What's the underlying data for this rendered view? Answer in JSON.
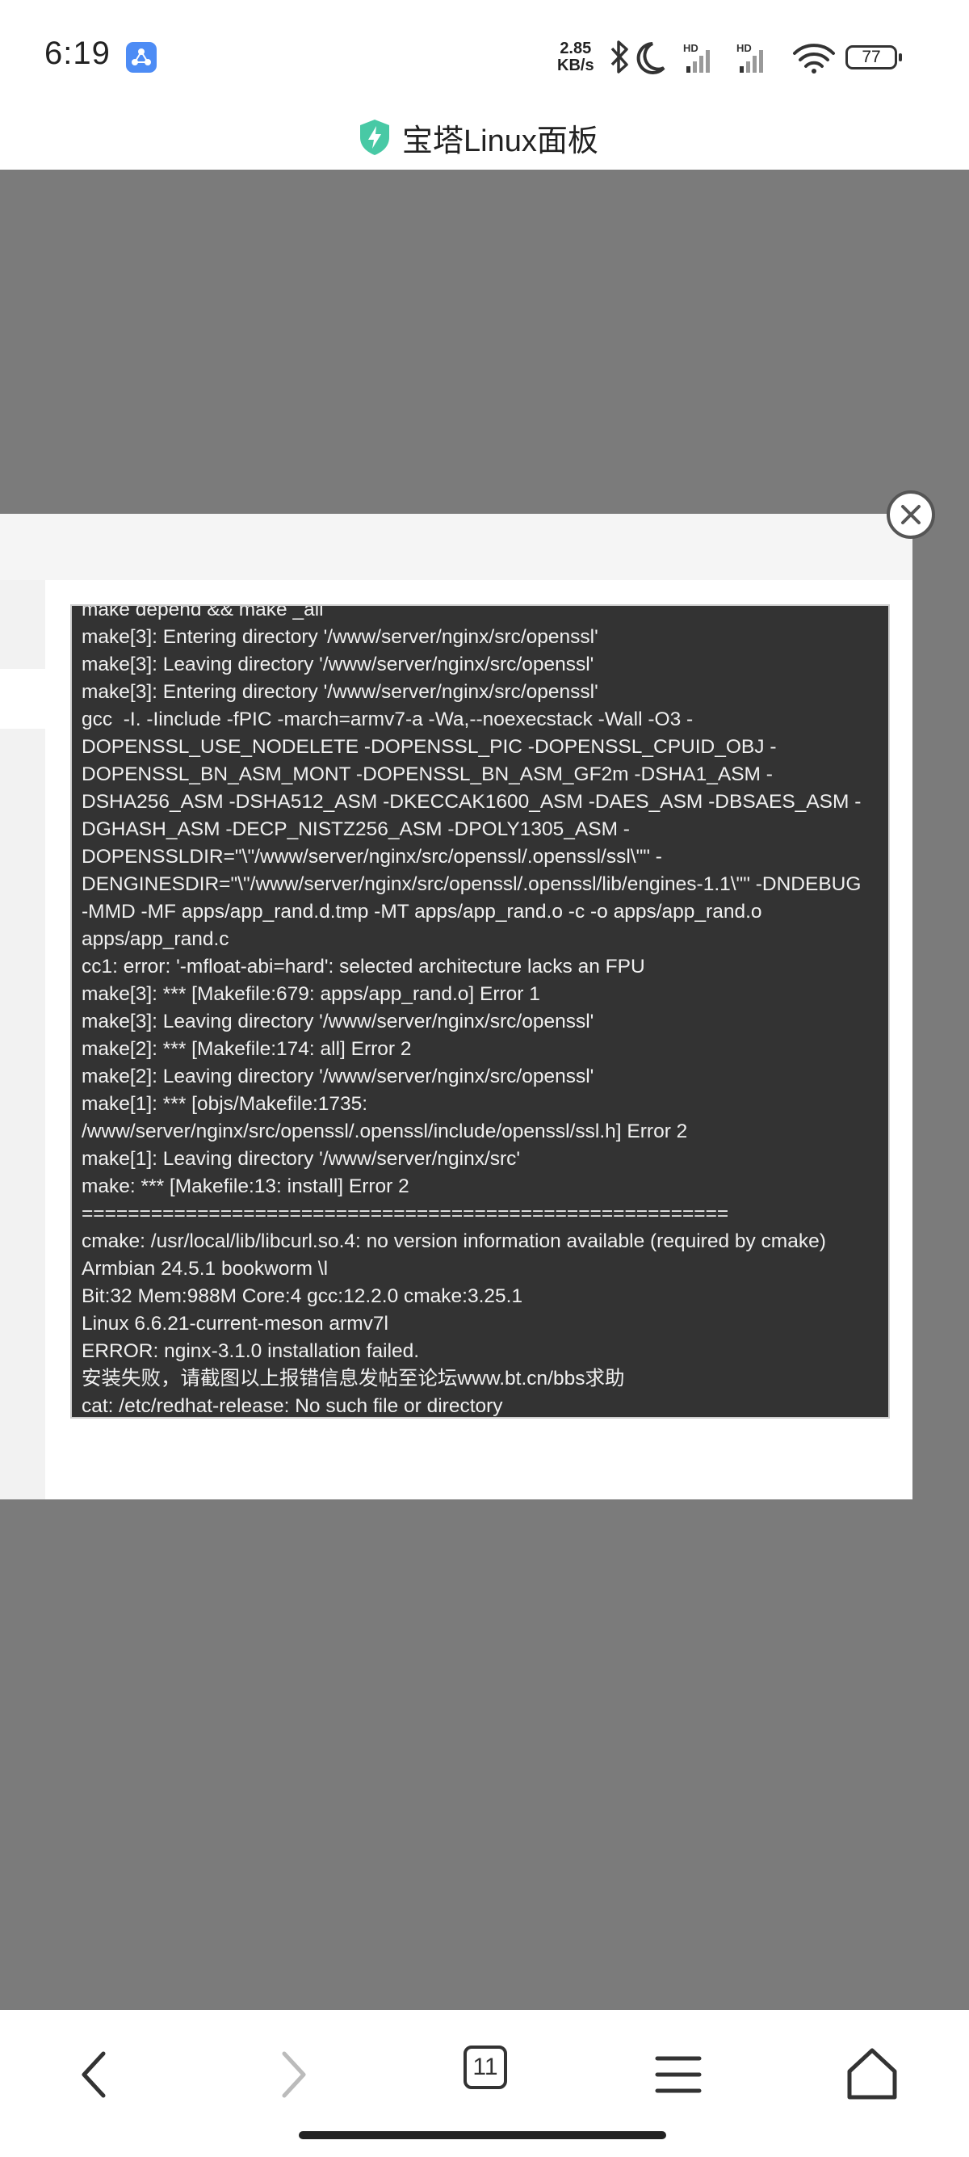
{
  "status_bar": {
    "time": "6:19",
    "net_speed_value": "2.85",
    "net_speed_unit": "KB/s",
    "battery": "77",
    "icons": [
      "app-notification-icon",
      "bluetooth-icon",
      "moon-icon",
      "signal-hd-icon",
      "signal-hd-icon",
      "wifi-icon",
      "battery-icon"
    ]
  },
  "title_bar": {
    "title": "宝塔Linux面板",
    "icon": "bt-shield-icon",
    "accent": "#20a53a"
  },
  "dialog": {
    "close_icon": "close-icon",
    "log_lines": [
      "make depend && make _all",
      "make[3]: Entering directory '/www/server/nginx/src/openssl'",
      "make[3]: Leaving directory '/www/server/nginx/src/openssl'",
      "make[3]: Entering directory '/www/server/nginx/src/openssl'",
      "gcc  -I. -Iinclude -fPIC -march=armv7-a -Wa,--noexecstack -Wall -O3 -",
      "DOPENSSL_USE_NODELETE -DOPENSSL_PIC -DOPENSSL_CPUID_OBJ -",
      "DOPENSSL_BN_ASM_MONT -DOPENSSL_BN_ASM_GF2m -DSHA1_ASM -",
      "DSHA256_ASM -DSHA512_ASM -DKECCAK1600_ASM -DAES_ASM -DBSAES_ASM -",
      "DGHASH_ASM -DECP_NISTZ256_ASM -DPOLY1305_ASM -",
      "DOPENSSLDIR=\"\\\"/www/server/nginx/src/openssl/.openssl/ssl\\\"\" -",
      "DENGINESDIR=\"\\\"/www/server/nginx/src/openssl/.openssl/lib/engines-1.1\\\"\" -DNDEBUG",
      "-MMD -MF apps/app_rand.d.tmp -MT apps/app_rand.o -c -o apps/app_rand.o",
      "apps/app_rand.c",
      "cc1: error: '-mfloat-abi=hard': selected architecture lacks an FPU",
      "make[3]: *** [Makefile:679: apps/app_rand.o] Error 1",
      "make[3]: Leaving directory '/www/server/nginx/src/openssl'",
      "make[2]: *** [Makefile:174: all] Error 2",
      "make[2]: Leaving directory '/www/server/nginx/src/openssl'",
      "make[1]: *** [objs/Makefile:1735:",
      "/www/server/nginx/src/openssl/.openssl/include/openssl/ssl.h] Error 2",
      "make[1]: Leaving directory '/www/server/nginx/src'",
      "make: *** [Makefile:13: install] Error 2",
      "========================================================",
      "cmake: /usr/local/lib/libcurl.so.4: no version information available (required by cmake)",
      "Armbian 24.5.1 bookworm \\l",
      "Bit:32 Mem:988M Core:4 gcc:12.2.0 cmake:3.25.1",
      "Linux 6.6.21-current-meson armv7l",
      "ERROR: nginx-3.1.0 installation failed.",
      "安装失败，请截图以上报错信息发帖至论坛www.bt.cn/bbs求助",
      "cat: /etc/redhat-release: No such file or directory"
    ]
  },
  "nav_bar": {
    "tab_count": "11",
    "icons": [
      "back-icon",
      "forward-icon",
      "tabs-icon",
      "menu-icon",
      "home-icon"
    ]
  }
}
